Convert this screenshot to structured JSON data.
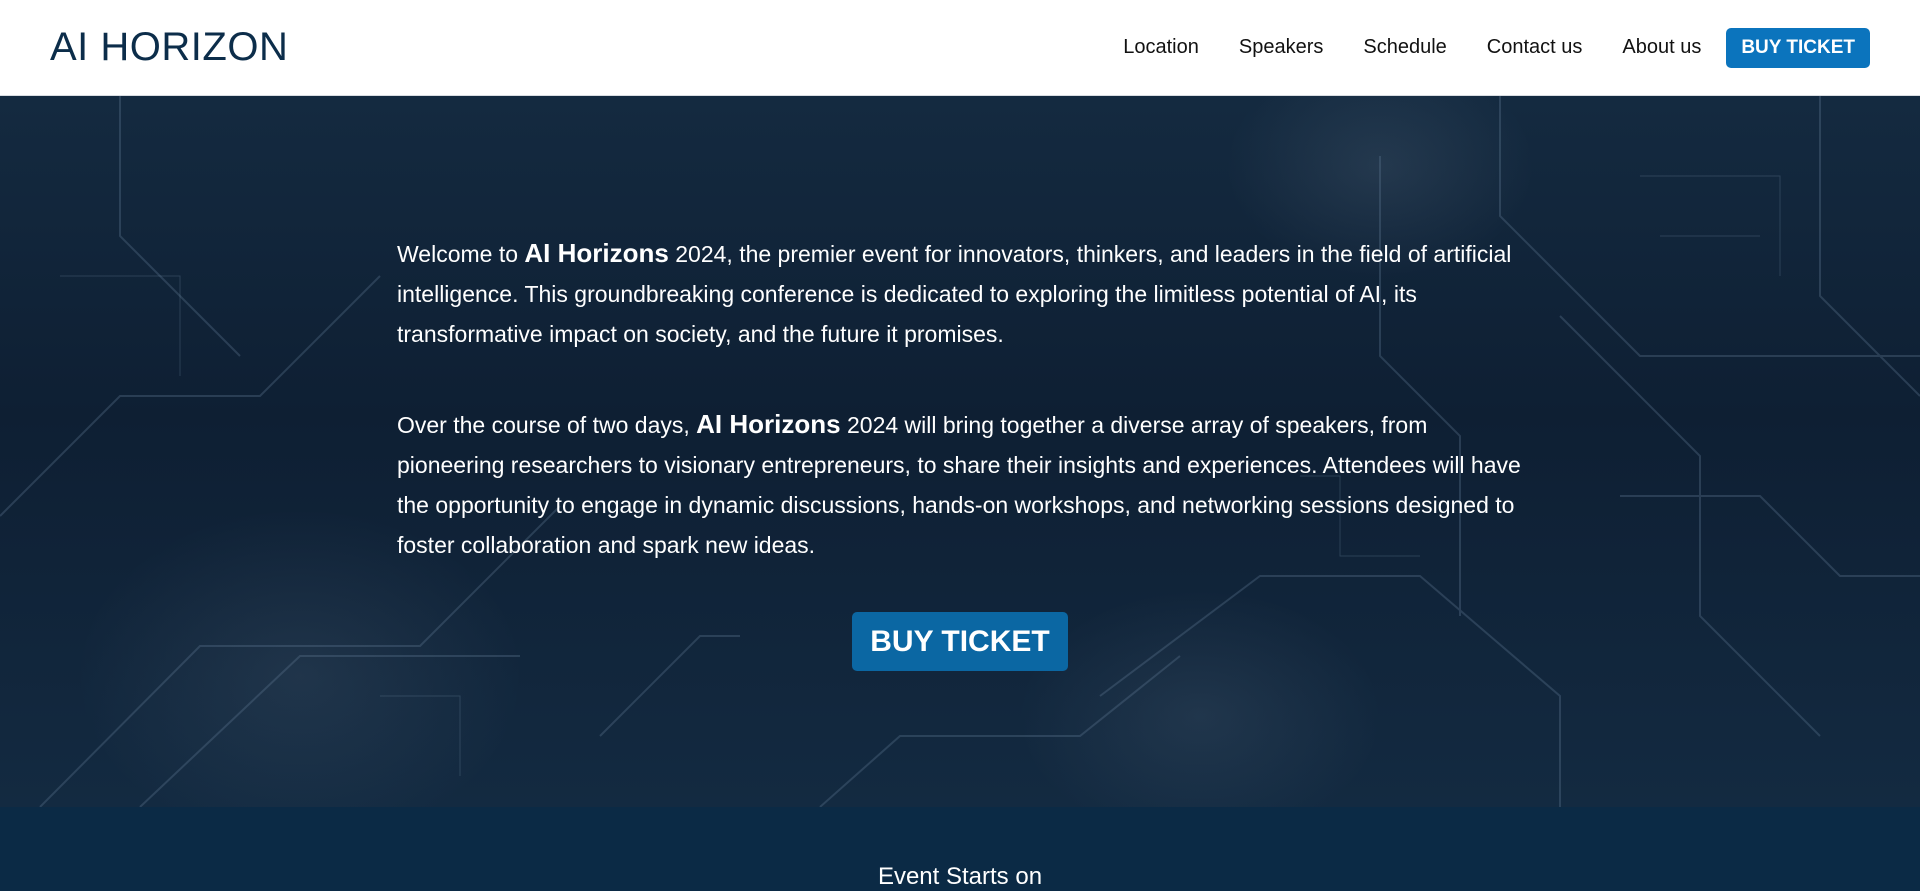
{
  "header": {
    "logo": "AI HORIZON",
    "nav": [
      "Location",
      "Speakers",
      "Schedule",
      "Contact us",
      "About us"
    ],
    "buy_label": "BUY TICKET"
  },
  "hero": {
    "p1_pre": "Welcome to ",
    "p1_bold": "AI Horizons",
    "p1_post": " 2024, the premier event for innovators, thinkers, and leaders in the field of artificial intelligence. This groundbreaking conference is dedicated to exploring the limitless potential of AI, its transformative impact on society, and the future it promises.",
    "p2_pre": "Over the course of two days, ",
    "p2_bold": "AI Horizons",
    "p2_post": " 2024 will bring together a diverse array of speakers, from pioneering researchers to visionary entrepreneurs, to share their insights and experiences. Attendees will have the opportunity to engage in dynamic discussions, hands-on workshops, and networking sessions designed to foster collaboration and spark new ideas.",
    "buy_label": "BUY TICKET"
  },
  "event": {
    "title": "Event Starts on"
  },
  "colors": {
    "accent": "#0b74bd",
    "header_bg": "#ffffff",
    "hero_bg": "#0f2236",
    "bottom_bg": "#0b2a45"
  }
}
